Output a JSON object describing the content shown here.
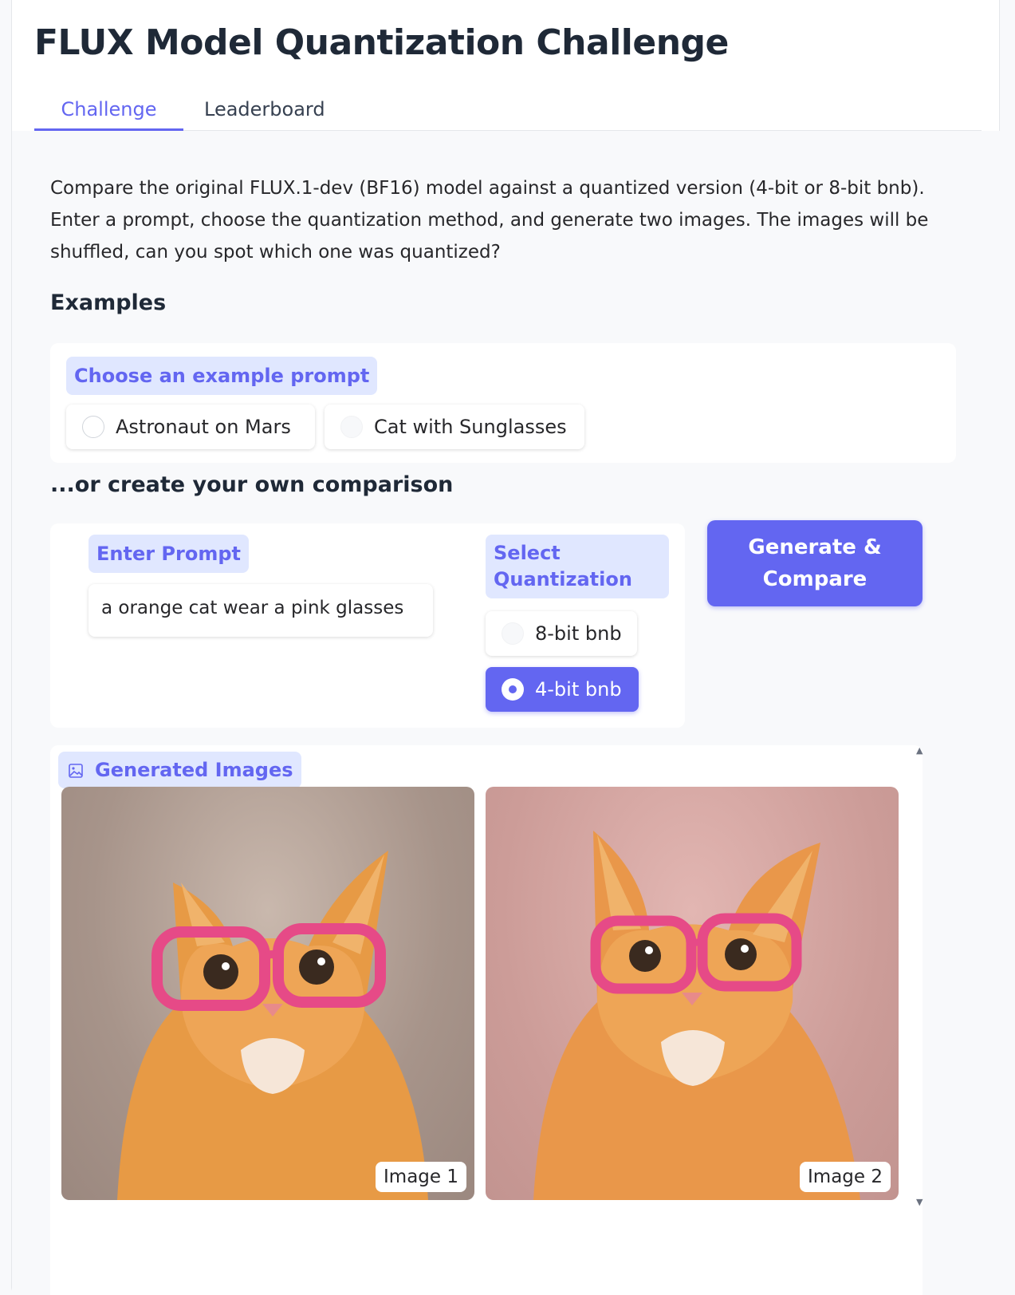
{
  "app": {
    "title": "FLUX Model Quantization Challenge",
    "accent_color": "#6366f1"
  },
  "tabs": [
    {
      "label": "Challenge",
      "active": true
    },
    {
      "label": "Leaderboard",
      "active": false
    }
  ],
  "description": "Compare the original FLUX.1-dev (BF16) model against a quantized version (4-bit or 8-bit bnb). Enter a prompt, choose the quantization method, and generate two images. The images will be shuffled, can you spot which one was quantized?",
  "examples": {
    "heading": "Examples",
    "label": "Choose an example prompt",
    "options": [
      {
        "label": "Astronaut on Mars",
        "selected": false
      },
      {
        "label": "Cat with Sunglasses",
        "selected": false
      }
    ]
  },
  "own": {
    "heading": "...or create your own comparison",
    "prompt_label": "Enter Prompt",
    "prompt_value": "a orange cat wear a pink glasses",
    "quant_label": "Select Quantization",
    "quant_options": [
      {
        "label": "8-bit bnb",
        "selected": false
      },
      {
        "label": "4-bit bnb",
        "selected": true
      }
    ],
    "generate_label": "Generate & Compare"
  },
  "gallery": {
    "label": "Generated Images",
    "icon": "image-icon",
    "images": [
      {
        "label": "Image 1"
      },
      {
        "label": "Image 2"
      }
    ]
  }
}
